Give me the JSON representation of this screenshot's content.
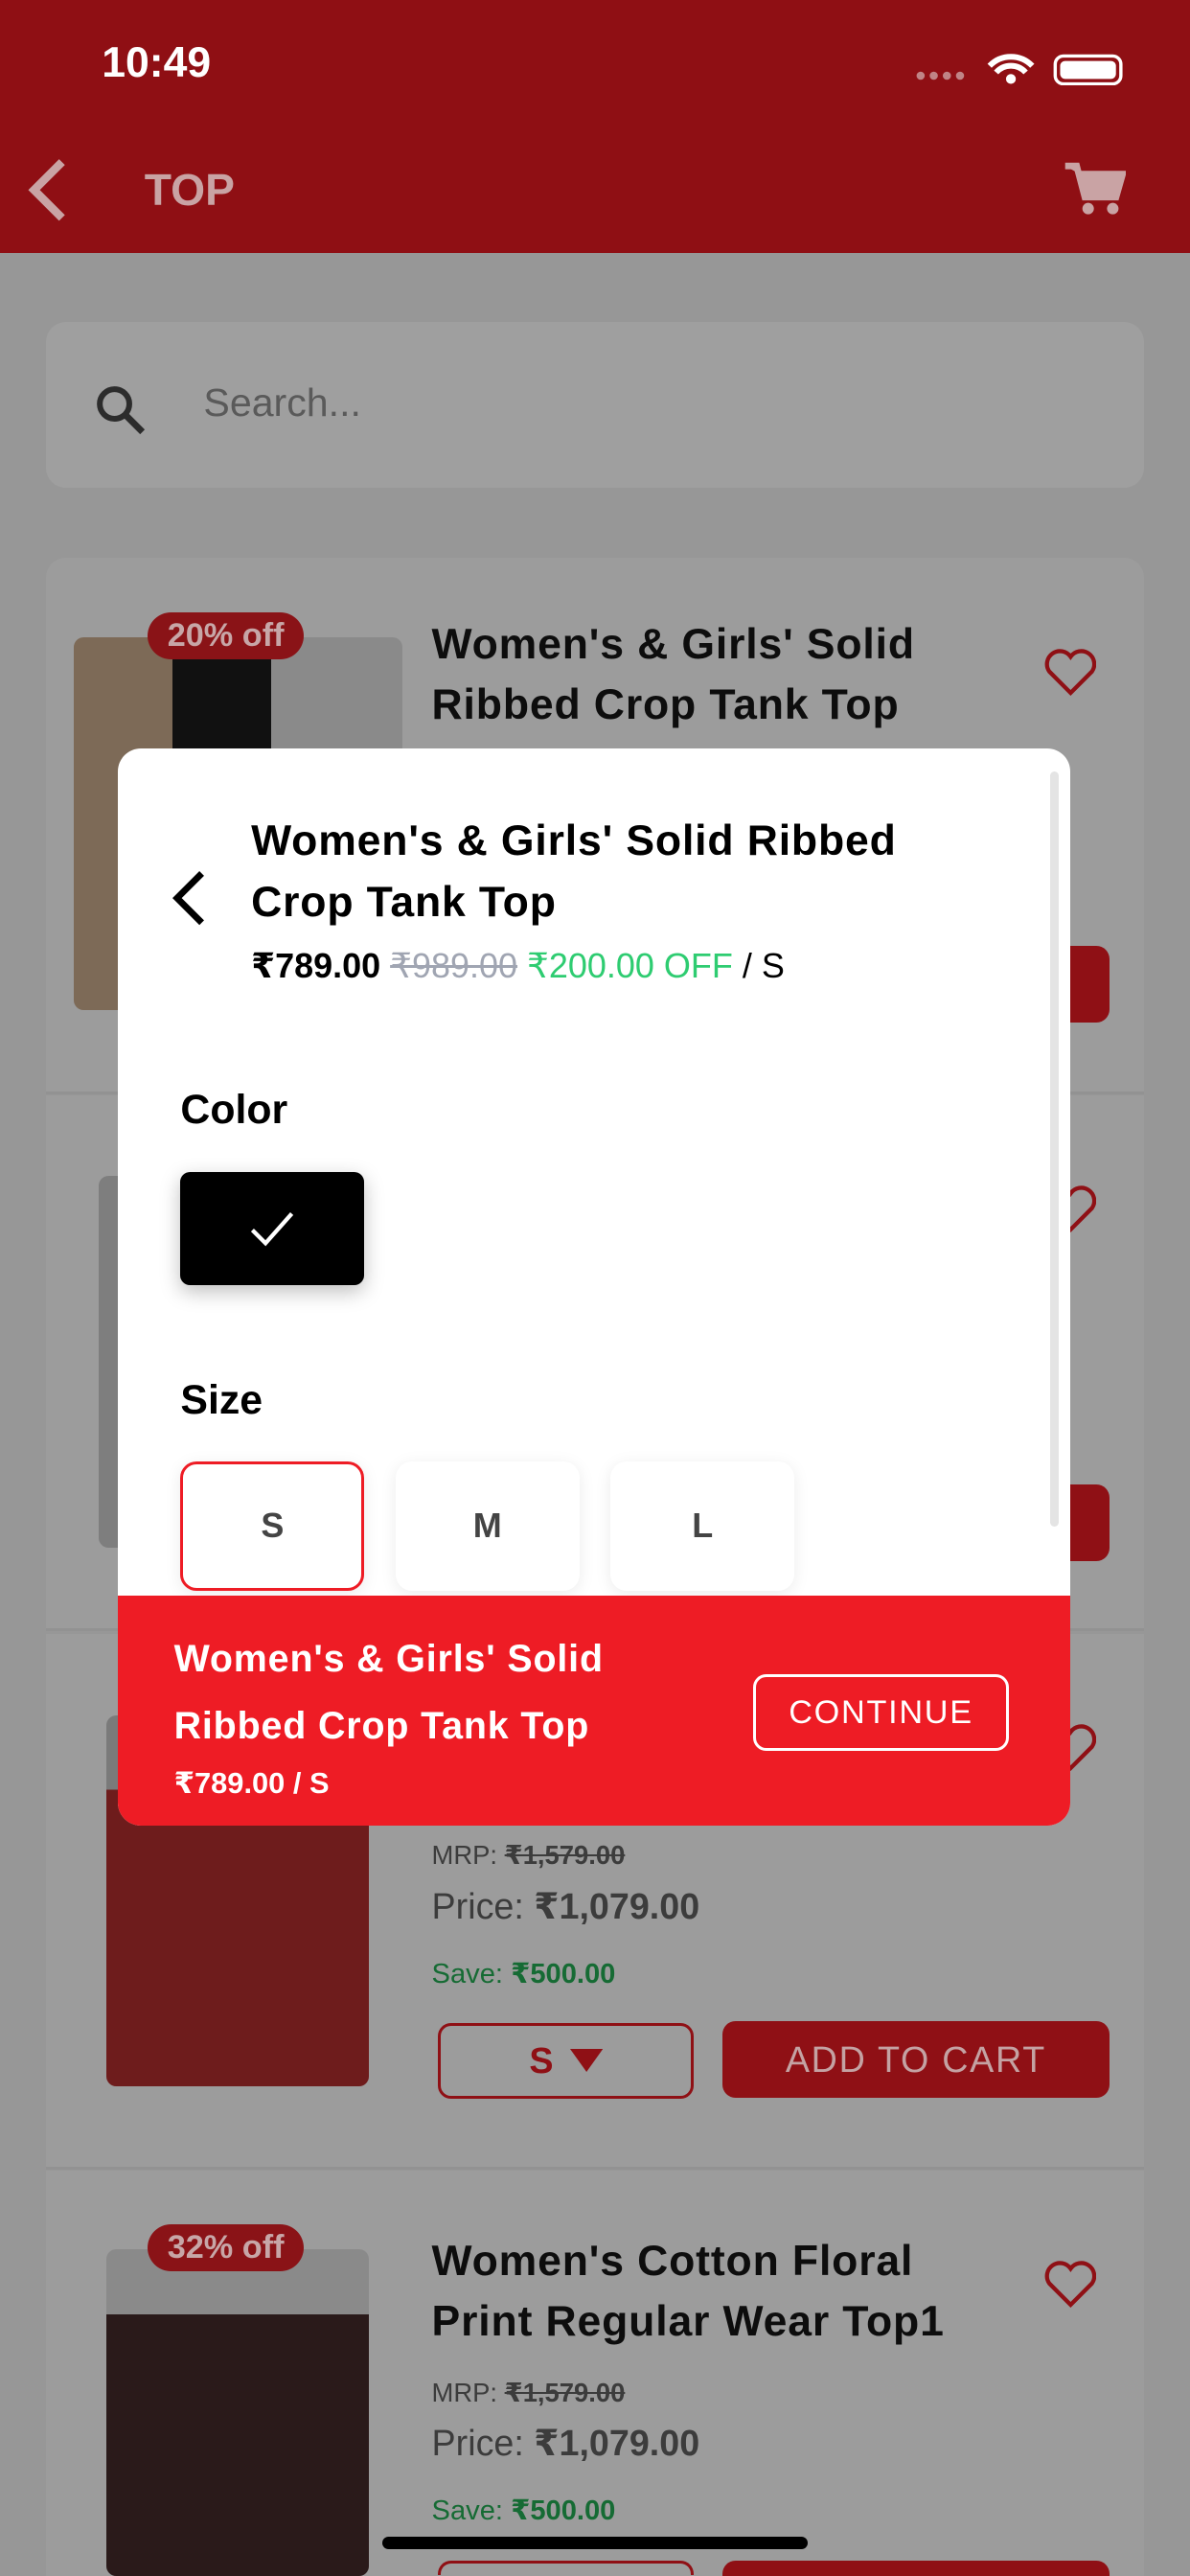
{
  "status_bar": {
    "time": "10:49"
  },
  "header": {
    "title": "TOP",
    "back_icon": "chevron-left-icon",
    "cart_icon": "cart-icon"
  },
  "search": {
    "placeholder": "Search..."
  },
  "colors": {
    "brand_red": "#ee1c25",
    "discount_green": "#2ecc71",
    "save_green": "#1f9a4b"
  },
  "products": [
    {
      "badge": "20% off",
      "title": "Women's & Girls' Solid Ribbed Crop Tank Top"
    },
    {},
    {
      "mrp_label": "MRP:",
      "mrp": "₹1,579.00",
      "price_label": "Price:",
      "price": "₹1,079.00",
      "save_label": "Save:",
      "save": "₹500.00",
      "size": "S",
      "add_to_cart": "ADD TO CART"
    },
    {
      "badge": "32% off",
      "title": "Women's Cotton Floral Print Regular Wear Top1",
      "mrp_label": "MRP:",
      "mrp": "₹1,579.00",
      "price_label": "Price:",
      "price": "₹1,079.00",
      "save_label": "Save:",
      "save": "₹500.00"
    }
  ],
  "modal": {
    "title": "Women's & Girls' Solid Ribbed Crop Tank Top",
    "price": "₹789.00",
    "original_price": "₹989.00",
    "discount": "₹200.00 OFF",
    "size_suffix": "/ S",
    "color_label": "Color",
    "selected_color": "#000000",
    "size_label": "Size",
    "sizes": [
      "S",
      "M",
      "L"
    ],
    "selected_size": "S",
    "footer": {
      "title_line1": "Women's & Girls' Solid",
      "title_line2": "Ribbed Crop Tank Top",
      "price": "₹789.00 / S",
      "continue": "CONTINUE"
    }
  }
}
